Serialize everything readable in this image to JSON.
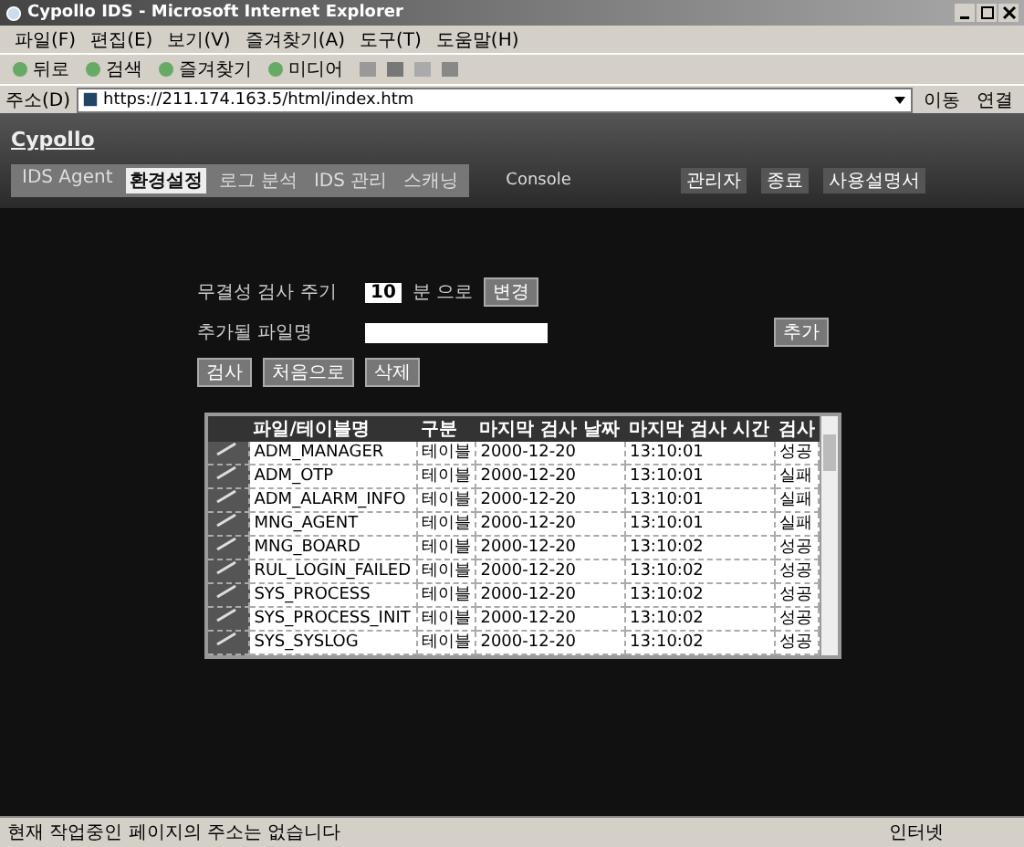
{
  "window": {
    "title": "Cypollo IDS - Microsoft Internet Explorer"
  },
  "menu": [
    "파일(F)",
    "편집(E)",
    "보기(V)",
    "즐겨찾기(A)",
    "도구(T)",
    "도움말(H)"
  ],
  "toolbar": [
    {
      "label": "뒤로"
    },
    {
      "label": "검색"
    },
    {
      "label": "즐겨찾기"
    },
    {
      "label": "미디어"
    }
  ],
  "address": {
    "label": "주소(D)",
    "url": "https://211.174.163.5/html/index.htm",
    "go": "이동",
    "links": "연결"
  },
  "app": {
    "logo": "Cypollo",
    "nav": [
      {
        "label": "IDS Agent",
        "selected": false
      },
      {
        "label": "환경설정",
        "selected": true
      },
      {
        "label": "로그 분석",
        "selected": false
      },
      {
        "label": "IDS 관리",
        "selected": false
      },
      {
        "label": "스캐닝",
        "selected": false
      }
    ],
    "console": "Console",
    "links": [
      "관리자",
      "종료",
      "사용설명서"
    ]
  },
  "form": {
    "period_label": "무결성 검사 주기",
    "period": "10",
    "unit": "분 으로",
    "change": "변경",
    "file_label": "추가될 파일명",
    "add": "추가",
    "buttons": [
      "검사",
      "처음으로",
      "삭제"
    ]
  },
  "table": {
    "columns": [
      "",
      "파일/테이블명",
      "구분",
      "마지막 검사 날짜",
      "마지막 검사 시간",
      "검사"
    ],
    "rows": [
      {
        "name": "ADM_MANAGER",
        "type": "테이블",
        "date": "2000-12-20",
        "time": "13:10:01",
        "result": "성공"
      },
      {
        "name": "ADM_OTP",
        "type": "테이블",
        "date": "2000-12-20",
        "time": "13:10:01",
        "result": "실패"
      },
      {
        "name": "ADM_ALARM_INFO",
        "type": "테이블",
        "date": "2000-12-20",
        "time": "13:10:01",
        "result": "실패"
      },
      {
        "name": "MNG_AGENT",
        "type": "테이블",
        "date": "2000-12-20",
        "time": "13:10:01",
        "result": "실패"
      },
      {
        "name": "MNG_BOARD",
        "type": "테이블",
        "date": "2000-12-20",
        "time": "13:10:02",
        "result": "성공"
      },
      {
        "name": "RUL_LOGIN_FAILED",
        "type": "테이블",
        "date": "2000-12-20",
        "time": "13:10:02",
        "result": "성공"
      },
      {
        "name": "SYS_PROCESS",
        "type": "테이블",
        "date": "2000-12-20",
        "time": "13:10:02",
        "result": "성공"
      },
      {
        "name": "SYS_PROCESS_INIT",
        "type": "테이블",
        "date": "2000-12-20",
        "time": "13:10:02",
        "result": "성공"
      },
      {
        "name": "SYS_SYSLOG",
        "type": "테이블",
        "date": "2000-12-20",
        "time": "13:10:02",
        "result": "성공"
      }
    ]
  },
  "status_bar": {
    "text": "현재 작업중인 페이지의 주소는 없습니다",
    "zone": "인터넷"
  }
}
